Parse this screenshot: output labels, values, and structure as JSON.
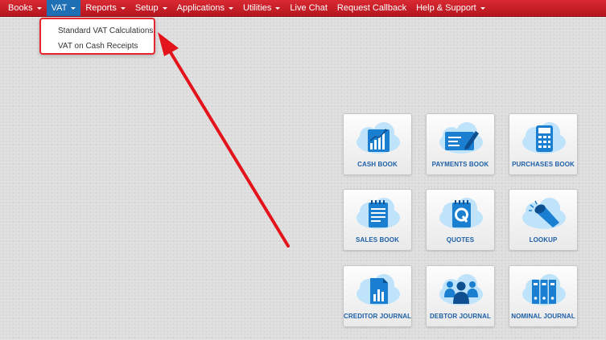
{
  "nav": {
    "items": [
      {
        "label": "Books",
        "has_caret": true
      },
      {
        "label": "VAT",
        "has_caret": true,
        "active": true
      },
      {
        "label": "Reports",
        "has_caret": true
      },
      {
        "label": "Setup",
        "has_caret": true
      },
      {
        "label": "Applications",
        "has_caret": true
      },
      {
        "label": "Utilities",
        "has_caret": true
      },
      {
        "label": "Live Chat",
        "has_caret": false
      },
      {
        "label": "Request Callback",
        "has_caret": false
      },
      {
        "label": "Help & Support",
        "has_caret": true
      }
    ],
    "color_bar": "#c81e27",
    "color_active": "#1f6fb4"
  },
  "vat_menu": {
    "items": [
      {
        "label": "Standard VAT Calculations"
      },
      {
        "label": "VAT on Cash Receipts"
      }
    ]
  },
  "tiles": [
    {
      "label": "CASH BOOK",
      "icon": "bar-chart-icon"
    },
    {
      "label": "PAYMENTS BOOK",
      "icon": "card-pencil-icon"
    },
    {
      "label": "PURCHASES BOOK",
      "icon": "calculator-icon"
    },
    {
      "label": "SALES BOOK",
      "icon": "notepad-icon"
    },
    {
      "label": "QUOTES",
      "icon": "quote-document-icon"
    },
    {
      "label": "LOOKUP",
      "icon": "flashlight-icon"
    },
    {
      "label": "CREDITOR JOURNAL",
      "icon": "report-chart-icon"
    },
    {
      "label": "DEBTOR JOURNAL",
      "icon": "people-group-icon"
    },
    {
      "label": "NOMINAL JOURNAL",
      "icon": "binders-icon"
    }
  ],
  "colors": {
    "tile_label": "#1d5fa6",
    "icon_blue": "#1a7fd1",
    "cloud": "#bfe3fb",
    "annotation_arrow": "#e3141b"
  }
}
